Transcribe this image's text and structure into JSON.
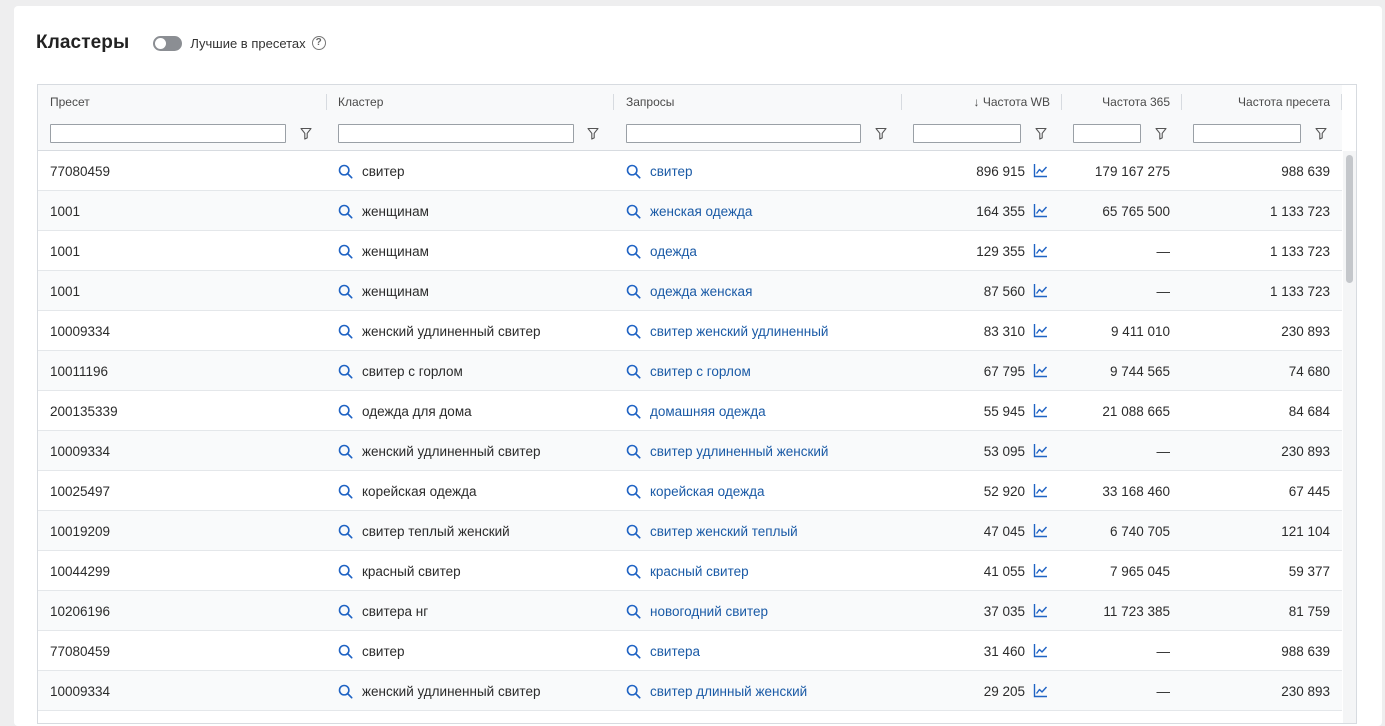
{
  "header": {
    "title": "Кластеры",
    "toggle_label": "Лучшие в пресетах",
    "help": "?"
  },
  "columns": {
    "preset": "Пресет",
    "cluster": "Кластер",
    "queries": "Запросы",
    "freq_wb": "↓ Частота WB",
    "freq_365": "Частота 365",
    "freq_preset": "Частота пресета"
  },
  "icons": {
    "search": "search-icon",
    "trend": "trend-chart-icon",
    "filter": "filter-icon",
    "help": "help-icon"
  },
  "colors": {
    "link": "#1a5aa6",
    "icon": "#1f63c4",
    "toggle_off": "#8b8e93"
  },
  "rows": [
    {
      "preset": "77080459",
      "cluster": "свитер",
      "query": "свитер",
      "wb": "896 915",
      "f365": "179 167 275",
      "fp": "988 639"
    },
    {
      "preset": "1001",
      "cluster": "женщинам",
      "query": "женская одежда",
      "wb": "164 355",
      "f365": "65 765 500",
      "fp": "1 133 723"
    },
    {
      "preset": "1001",
      "cluster": "женщинам",
      "query": "одежда",
      "wb": "129 355",
      "f365": "—",
      "fp": "1 133 723"
    },
    {
      "preset": "1001",
      "cluster": "женщинам",
      "query": "одежда женская",
      "wb": "87 560",
      "f365": "—",
      "fp": "1 133 723"
    },
    {
      "preset": "10009334",
      "cluster": "женский удлиненный свитер",
      "query": "свитер женский удлиненный",
      "wb": "83 310",
      "f365": "9 411 010",
      "fp": "230 893"
    },
    {
      "preset": "10011196",
      "cluster": "свитер с горлом",
      "query": "свитер с горлом",
      "wb": "67 795",
      "f365": "9 744 565",
      "fp": "74 680"
    },
    {
      "preset": "200135339",
      "cluster": "одежда для дома",
      "query": "домашняя одежда",
      "wb": "55 945",
      "f365": "21 088 665",
      "fp": "84 684"
    },
    {
      "preset": "10009334",
      "cluster": "женский удлиненный свитер",
      "query": "свитер удлиненный женский",
      "wb": "53 095",
      "f365": "—",
      "fp": "230 893"
    },
    {
      "preset": "10025497",
      "cluster": "корейская одежда",
      "query": "корейская одежда",
      "wb": "52 920",
      "f365": "33 168 460",
      "fp": "67 445"
    },
    {
      "preset": "10019209",
      "cluster": "свитер теплый женский",
      "query": "свитер женский теплый",
      "wb": "47 045",
      "f365": "6 740 705",
      "fp": "121 104"
    },
    {
      "preset": "10044299",
      "cluster": "красный свитер",
      "query": "красный свитер",
      "wb": "41 055",
      "f365": "7 965 045",
      "fp": "59 377"
    },
    {
      "preset": "10206196",
      "cluster": "свитера нг",
      "query": "новогодний свитер",
      "wb": "37 035",
      "f365": "11 723 385",
      "fp": "81 759"
    },
    {
      "preset": "77080459",
      "cluster": "свитер",
      "query": "свитера",
      "wb": "31 460",
      "f365": "—",
      "fp": "988 639"
    },
    {
      "preset": "10009334",
      "cluster": "женский удлиненный свитер",
      "query": "свитер длинный женский",
      "wb": "29 205",
      "f365": "—",
      "fp": "230 893"
    }
  ]
}
